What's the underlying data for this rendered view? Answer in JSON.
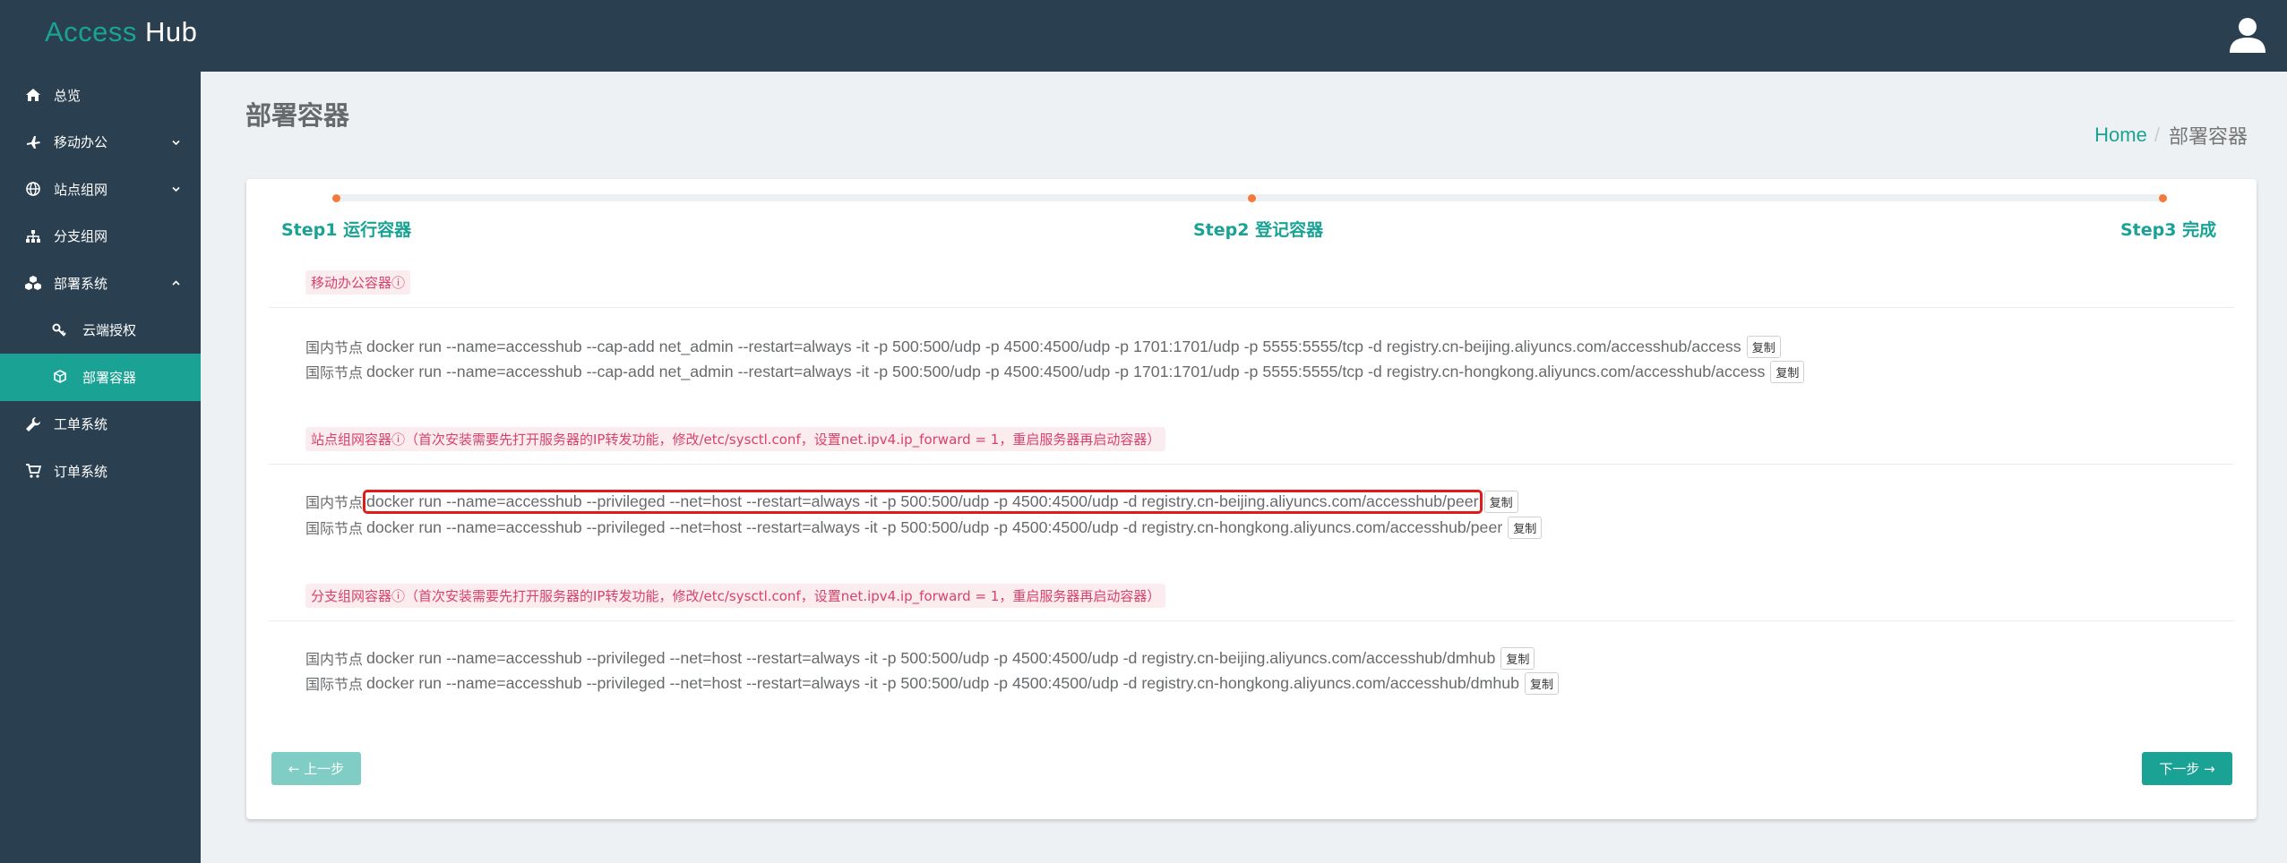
{
  "header": {
    "logo_part1": "Access",
    "logo_part2": " Hub",
    "user_icon": "user-icon"
  },
  "sidebar": {
    "items": [
      {
        "label": "总览",
        "icon": "home-icon"
      },
      {
        "label": "移动办公",
        "icon": "plane-icon",
        "expandable": true
      },
      {
        "label": "站点组网",
        "icon": "globe-icon",
        "expandable": true
      },
      {
        "label": "分支组网",
        "icon": "sitemap-icon"
      },
      {
        "label": "部署系统",
        "icon": "cubes-icon",
        "expanded": true
      },
      {
        "label": "云端授权",
        "icon": "key-icon",
        "sub": true
      },
      {
        "label": "部署容器",
        "icon": "cube-icon",
        "sub": true,
        "active": true
      },
      {
        "label": "工单系统",
        "icon": "wrench-icon"
      },
      {
        "label": "订单系统",
        "icon": "cart-icon"
      }
    ]
  },
  "page": {
    "title": "部署容器",
    "breadcrumb_home": "Home",
    "breadcrumb_sep": "/",
    "breadcrumb_current": "部署容器"
  },
  "steps": {
    "step1": "Step1 运行容器",
    "step2": "Step2 登记容器",
    "step3": "Step3 完成"
  },
  "sections": {
    "mobile": {
      "label": "移动办公容器ⓘ",
      "lines": [
        {
          "node": "国内节点",
          "cmd": "docker run --name=accesshub --cap-add net_admin --restart=always -it -p 500:500/udp -p 4500:4500/udp -p 1701:1701/udp -p 5555:5555/tcp -d registry.cn-beijing.aliyuncs.com/accesshub/access",
          "copy": "复制"
        },
        {
          "node": "国际节点",
          "cmd": "docker run --name=accesshub --cap-add net_admin --restart=always -it -p 500:500/udp -p 4500:4500/udp -p 1701:1701/udp -p 5555:5555/tcp -d registry.cn-hongkong.aliyuncs.com/accesshub/access",
          "copy": "复制"
        }
      ]
    },
    "site": {
      "label": "站点组网容器ⓘ（首次安装需要先打开服务器的IP转发功能，修改/etc/sysctl.conf，设置net.ipv4.ip_forward = 1，重启服务器再启动容器）",
      "lines": [
        {
          "node": "国内节点",
          "cmd": "docker run --name=accesshub --privileged --net=host --restart=always -it -p 500:500/udp -p 4500:4500/udp -d registry.cn-beijing.aliyuncs.com/accesshub/peer",
          "copy": "复制"
        },
        {
          "node": "国际节点",
          "cmd": "docker run --name=accesshub --privileged --net=host --restart=always -it -p 500:500/udp -p 4500:4500/udp -d registry.cn-hongkong.aliyuncs.com/accesshub/peer",
          "copy": "复制"
        }
      ]
    },
    "branch": {
      "label": "分支组网容器ⓘ（首次安装需要先打开服务器的IP转发功能，修改/etc/sysctl.conf，设置net.ipv4.ip_forward = 1，重启服务器再启动容器）",
      "lines": [
        {
          "node": "国内节点",
          "cmd": "docker run --name=accesshub --privileged --net=host --restart=always -it -p 500:500/udp -p 4500:4500/udp -d registry.cn-beijing.aliyuncs.com/accesshub/dmhub",
          "copy": "复制"
        },
        {
          "node": "国际节点",
          "cmd": "docker run --name=accesshub --privileged --net=host --restart=always -it -p 500:500/udp -p 4500:4500/udp -d registry.cn-hongkong.aliyuncs.com/accesshub/dmhub",
          "copy": "复制"
        }
      ]
    }
  },
  "buttons": {
    "prev": "← 上一步",
    "next": "下一步 →"
  },
  "colors": {
    "accent": "#1aa394",
    "sidebar_bg": "#2a3f4f",
    "step_dot": "#f47a3b",
    "label_text": "#d8426b",
    "highlight_box": "#e01b1b"
  }
}
